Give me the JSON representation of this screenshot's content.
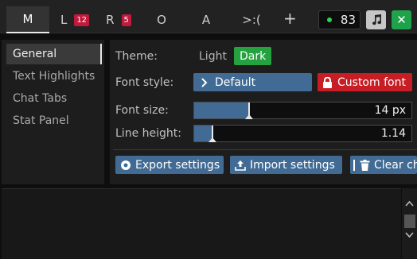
{
  "tabs": [
    {
      "label": "M",
      "badge": null,
      "active": true
    },
    {
      "label": "L",
      "badge": "12"
    },
    {
      "label": "R",
      "badge": "5"
    },
    {
      "label": "O",
      "badge": null
    },
    {
      "label": "A",
      "badge": null
    },
    {
      "label": ">:(",
      "badge": null
    }
  ],
  "add_tab_label": "+",
  "online_count": "83",
  "close_label": "✕",
  "sidebar": {
    "items": [
      {
        "label": "General",
        "active": true
      },
      {
        "label": "Text Highlights"
      },
      {
        "label": "Chat Tabs"
      },
      {
        "label": "Stat Panel"
      }
    ]
  },
  "settings": {
    "theme_label": "Theme:",
    "theme_light": "Light",
    "theme_dark": "Dark",
    "font_style_label": "Font style:",
    "font_default": "Default",
    "font_custom": "Custom font",
    "font_size_label": "Font size:",
    "font_size_value": "14 px",
    "font_size_fraction": 0.25,
    "line_height_label": "Line height:",
    "line_height_value": "1.14",
    "line_height_fraction": 0.08
  },
  "actions": {
    "export": "Export settings",
    "import": "Import settings",
    "clear": "Clear ch"
  },
  "colors": {
    "accent_blue": "#416b94",
    "green": "#24a23f",
    "red": "#c71e26",
    "badge_red": "#c01a3c",
    "online_dot": "#33d14c"
  }
}
